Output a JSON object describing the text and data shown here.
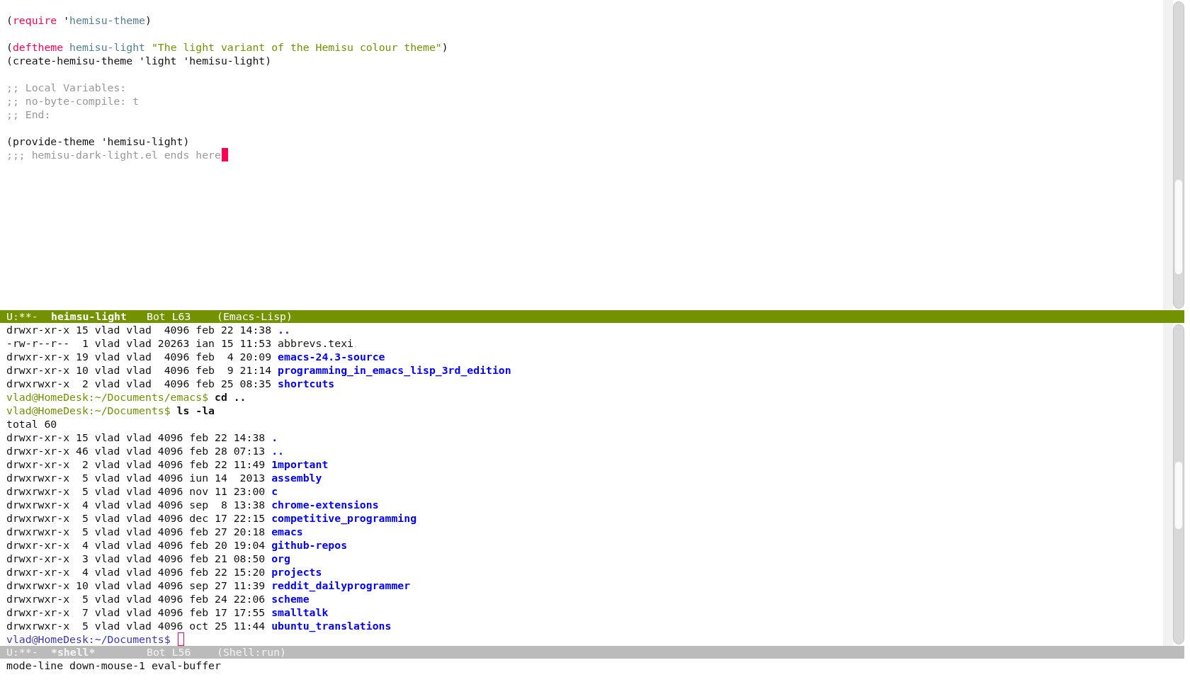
{
  "editor_pane": {
    "active": true,
    "blocks": [
      [
        [
          {
            "text": "(",
            "kind": "plain"
          },
          {
            "text": "require",
            "kind": "keyword"
          },
          {
            "text": " '",
            "kind": "plain"
          },
          {
            "text": "hemisu-theme",
            "kind": "name"
          },
          {
            "text": ")",
            "kind": "plain"
          }
        ]
      ],
      [
        [
          {
            "text": "(",
            "kind": "plain"
          },
          {
            "text": "deftheme",
            "kind": "keyword"
          },
          {
            "text": " hemisu-light",
            "kind": "name"
          },
          {
            "text": " \"The light variant of the Hemisu colour theme\"",
            "kind": "string"
          },
          {
            "text": ")",
            "kind": "plain"
          }
        ],
        [
          {
            "text": "(create-hemisu-theme 'light 'hemisu-light)",
            "kind": "plain"
          }
        ]
      ],
      [
        [
          {
            "text": ";; Local Variables:",
            "kind": "comment"
          }
        ],
        [
          {
            "text": ";; no-byte-compile: t",
            "kind": "comment"
          }
        ],
        [
          {
            "text": ";; End:",
            "kind": "comment"
          }
        ]
      ],
      [
        [
          {
            "text": "(provide-theme 'hemisu-light)",
            "kind": "plain"
          }
        ],
        [
          {
            "text": ";;; hemisu-dark-light.el ends here",
            "kind": "comment"
          }
        ]
      ]
    ],
    "mode_line": {
      "status": "U:**-",
      "buffer": "heimsu-light",
      "position": "Bot L63",
      "mode": "(Emacs-Lisp)"
    }
  },
  "shell_pane": {
    "active": false,
    "lines": [
      [
        {
          "text": "drwxr-xr-x 15 vlad vlad  4096 feb 22 14:38 ",
          "kind": "plain"
        },
        {
          "text": "..",
          "kind": "dir"
        }
      ],
      [
        {
          "text": "-rw-r--r--  1 vlad vlad 20263 ian 15 11:53 ",
          "kind": "plain"
        },
        {
          "text": "abbrevs.texi",
          "kind": "plain"
        }
      ],
      [
        {
          "text": "drwxr-xr-x 19 vlad vlad  4096 feb  4 20:09 ",
          "kind": "plain"
        },
        {
          "text": "emacs-24.3-source",
          "kind": "dir"
        }
      ],
      [
        {
          "text": "drwxr-xr-x 10 vlad vlad  4096 feb  9 21:14 ",
          "kind": "plain"
        },
        {
          "text": "programming_in_emacs_lisp_3rd_edition",
          "kind": "dir"
        }
      ],
      [
        {
          "text": "drwxrwxr-x  2 vlad vlad  4096 feb 25 08:35 ",
          "kind": "plain"
        },
        {
          "text": "shortcuts",
          "kind": "dir"
        }
      ],
      [
        {
          "text": "vlad@HomeDesk:~/Documents/emacs$ ",
          "kind": "prompt"
        },
        {
          "text": "cd ..",
          "kind": "command"
        }
      ],
      [
        {
          "text": "vlad@HomeDesk:~/Documents$ ",
          "kind": "prompt"
        },
        {
          "text": "ls -la",
          "kind": "command"
        }
      ],
      [
        {
          "text": "total 60",
          "kind": "plain"
        }
      ],
      [
        {
          "text": "drwxr-xr-x 15 vlad vlad 4096 feb 22 14:38 ",
          "kind": "plain"
        },
        {
          "text": ".",
          "kind": "dir"
        }
      ],
      [
        {
          "text": "drwxr-xr-x 46 vlad vlad 4096 feb 28 07:13 ",
          "kind": "plain"
        },
        {
          "text": "..",
          "kind": "dir"
        }
      ],
      [
        {
          "text": "drwxr-xr-x  2 vlad vlad 4096 feb 22 11:49 ",
          "kind": "plain"
        },
        {
          "text": "1mportant",
          "kind": "dir"
        }
      ],
      [
        {
          "text": "drwxrwxr-x  5 vlad vlad 4096 iun 14  2013 ",
          "kind": "plain"
        },
        {
          "text": "assembly",
          "kind": "dir"
        }
      ],
      [
        {
          "text": "drwxrwxr-x  5 vlad vlad 4096 nov 11 23:00 ",
          "kind": "plain"
        },
        {
          "text": "c",
          "kind": "dir"
        }
      ],
      [
        {
          "text": "drwxrwxr-x  4 vlad vlad 4096 sep  8 13:38 ",
          "kind": "plain"
        },
        {
          "text": "chrome-extensions",
          "kind": "dir"
        }
      ],
      [
        {
          "text": "drwxrwxr-x  5 vlad vlad 4096 dec 17 22:15 ",
          "kind": "plain"
        },
        {
          "text": "competitive_programming",
          "kind": "dir"
        }
      ],
      [
        {
          "text": "drwxrwxr-x  5 vlad vlad 4096 feb 27 20:18 ",
          "kind": "plain"
        },
        {
          "text": "emacs",
          "kind": "dir"
        }
      ],
      [
        {
          "text": "drwxr-xr-x  4 vlad vlad 4096 feb 20 19:04 ",
          "kind": "plain"
        },
        {
          "text": "github-repos",
          "kind": "dir"
        }
      ],
      [
        {
          "text": "drwxr-xr-x  3 vlad vlad 4096 feb 21 08:50 ",
          "kind": "plain"
        },
        {
          "text": "org",
          "kind": "dir"
        }
      ],
      [
        {
          "text": "drwxr-xr-x  4 vlad vlad 4096 feb 22 15:20 ",
          "kind": "plain"
        },
        {
          "text": "projects",
          "kind": "dir"
        }
      ],
      [
        {
          "text": "drwxrwxr-x 10 vlad vlad 4096 sep 27 11:39 ",
          "kind": "plain"
        },
        {
          "text": "reddit_dailyprogrammer",
          "kind": "dir"
        }
      ],
      [
        {
          "text": "drwxrwxr-x  5 vlad vlad 4096 feb 24 22:06 ",
          "kind": "plain"
        },
        {
          "text": "scheme",
          "kind": "dir"
        }
      ],
      [
        {
          "text": "drwxr-xr-x  7 vlad vlad 4096 feb 17 17:55 ",
          "kind": "plain"
        },
        {
          "text": "smalltalk",
          "kind": "dir"
        }
      ],
      [
        {
          "text": "drwxrwxr-x  5 vlad vlad 4096 oct 25 11:44 ",
          "kind": "plain"
        },
        {
          "text": "ubuntu_translations",
          "kind": "dir"
        }
      ],
      [
        {
          "text": "vlad@HomeDesk:~/Documents$",
          "kind": "current_prompt"
        }
      ]
    ],
    "mode_line": {
      "status": "U:**-",
      "buffer": "*shell*",
      "position": "Bot L56",
      "mode": "(Shell:run)"
    }
  },
  "minibuffer": "mode-line down-mouse-1 eval-buffer"
}
